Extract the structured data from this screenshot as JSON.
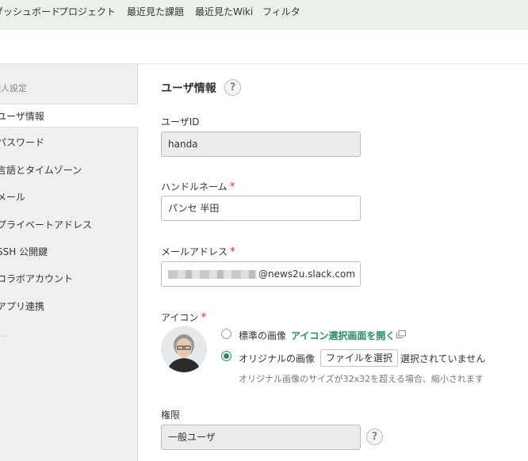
{
  "topnav": {
    "items": [
      "ダッシュボード",
      "プロジェクト",
      "最近見た課題",
      "最近見たWiki",
      "フィルタ"
    ]
  },
  "sidebar": {
    "heading": "個人設定",
    "items": [
      "ユーザ情報",
      "パスワード",
      "言語とタイムゾーン",
      "メール",
      "プライベートアドレス",
      "SSH 公開鍵",
      "コラボアカウント",
      "アプリ連携",
      "…"
    ],
    "active_index": 0
  },
  "main": {
    "title": "ユーザ情報",
    "help_symbol": "?",
    "user_id": {
      "label": "ユーザID",
      "value": "handa"
    },
    "handle": {
      "label": "ハンドルネーム",
      "required_mark": "*",
      "value": "パンセ 半田"
    },
    "email": {
      "label": "メールアドレス",
      "required_mark": "*",
      "value_suffix": "@news2u.slack.com"
    },
    "icon": {
      "label": "アイコン",
      "required_mark": "*",
      "option_standard": "標準の画像",
      "open_picker_link": "アイコン選択画面を開く",
      "option_original": "オリジナルの画像",
      "file_button": "ファイルを選択",
      "file_status": "選択されていません",
      "note": "オリジナル画像のサイズが32x32を超える場合、縮小されます",
      "selected": "original"
    },
    "role": {
      "label": "権限",
      "value": "一般ユーザ"
    }
  },
  "colors": {
    "accent": "#2a8a6a",
    "required": "#e03333",
    "nav_bg": "#edf1ec",
    "sidebar_bg": "#f0f0f0"
  }
}
